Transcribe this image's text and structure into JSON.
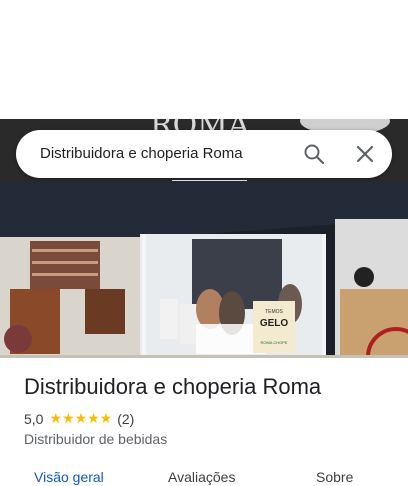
{
  "search": {
    "query": "Distribuidora e choperia Roma"
  },
  "icons": {
    "search": "search-icon",
    "close": "close-icon"
  },
  "photo": {
    "sign_top": "TEMOS",
    "sign_main": "GELO",
    "sign_bottom": "ROMA CHOPE"
  },
  "place": {
    "name": "Distribuidora e choperia Roma",
    "rating": "5,0",
    "stars": "★★★★★",
    "review_count": "(2)",
    "category": "Distribuidor de bebidas"
  },
  "tabs": [
    "Visão geral",
    "Avaliações",
    "Sobre"
  ],
  "colors": {
    "accent": "#0b57d0",
    "star": "#fbbc04",
    "text": "#202124"
  }
}
